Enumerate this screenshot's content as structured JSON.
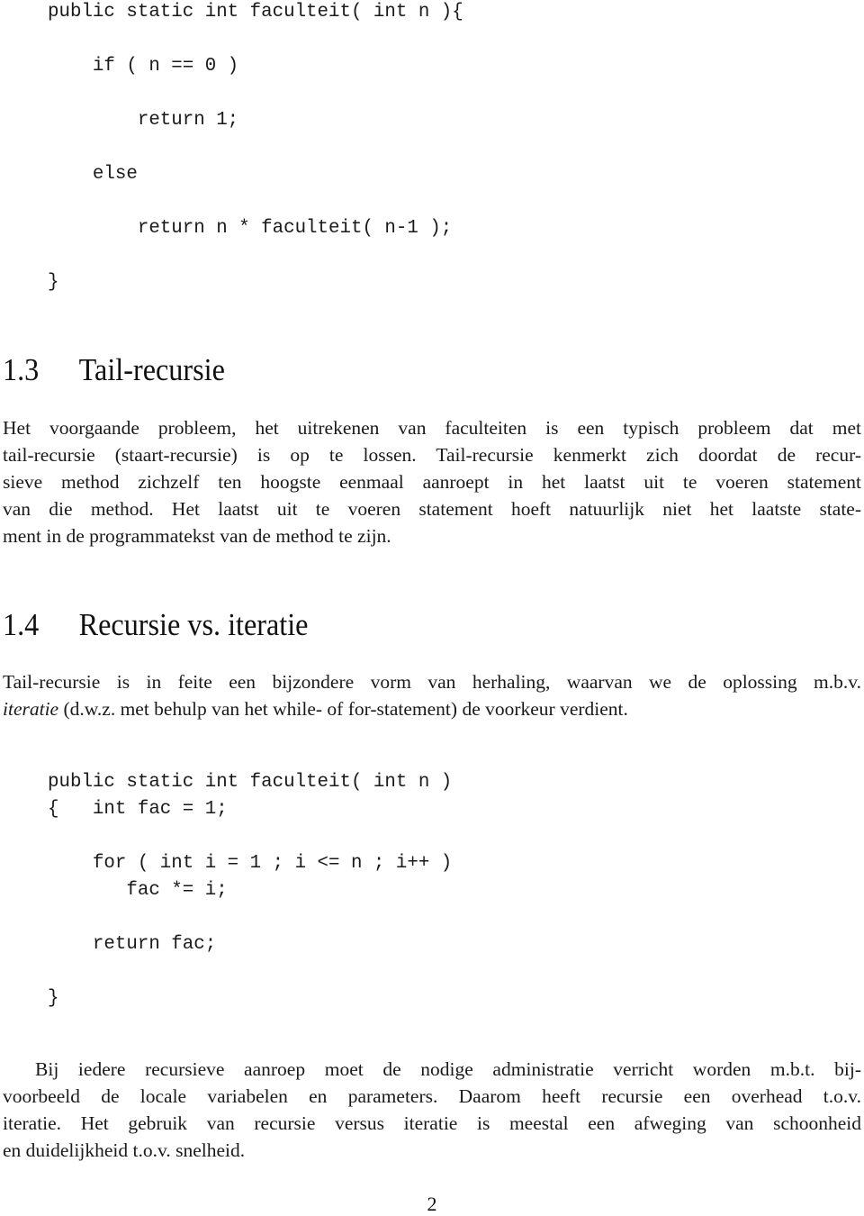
{
  "code_block_1": {
    "lines": [
      "public static int faculteit( int n ){",
      "    if ( n == 0 )",
      "        return 1;",
      "    else",
      "        return n * faculteit( n-1 );",
      "}"
    ]
  },
  "section_1_3": {
    "number": "1.3",
    "title": "Tail-recursie",
    "paragraph_lines": [
      "Het voorgaande probleem, het uitrekenen van faculteiten is een typisch probleem dat met",
      "tail-recursie (staart-recursie) is op te lossen. Tail-recursie kenmerkt zich doordat de recur-",
      "sieve method zichzelf ten hoogste eenmaal aanroept in het laatst uit te voeren statement",
      "van die method. Het laatst uit te voeren statement hoeft natuurlijk niet het laatste state-",
      "ment in de programmatekst van de method te zijn."
    ]
  },
  "section_1_4": {
    "number": "1.4",
    "title": "Recursie vs. iteratie",
    "paragraph_line_1": "Tail-recursie is in feite een bijzondere vorm van herhaling, waarvan we de oplossing m.b.v.",
    "paragraph_line_2_italic": "iteratie",
    "paragraph_line_2_rest": " (d.w.z. met behulp van het while- of for-statement) de voorkeur verdient."
  },
  "code_block_2": {
    "lines": [
      "public static int faculteit( int n )",
      "{   int fac = 1;",
      "",
      "    for ( int i = 1 ; i <= n ; i++ )",
      "       fac *= i;",
      "",
      "    return fac;",
      "",
      "}"
    ]
  },
  "closing_paragraph": {
    "lines": [
      "Bij iedere recursieve aanroep moet de nodige administratie verricht worden m.b.t. bij-",
      "voorbeeld de locale variabelen en parameters. Daarom heeft recursie een overhead t.o.v.",
      "iteratie. Het gebruik van recursie versus iteratie is meestal een afweging van schoonheid",
      "en duidelijkheid t.o.v. snelheid."
    ]
  },
  "page_number": "2"
}
